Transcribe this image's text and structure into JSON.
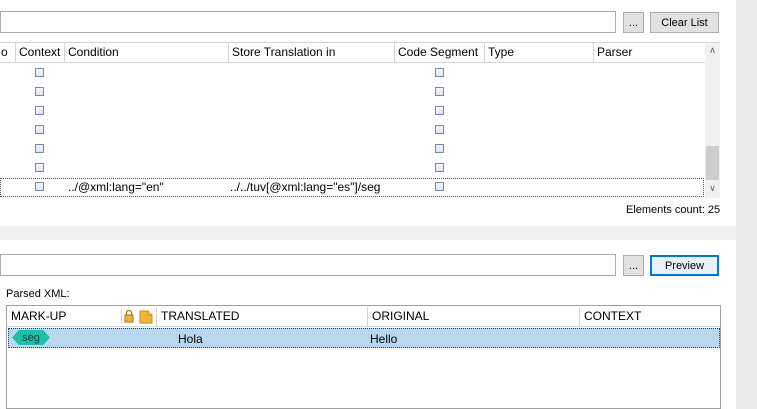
{
  "toolbar_top": {
    "browse_label": "...",
    "clear_list_label": "Clear List"
  },
  "elements_grid": {
    "columns": [
      "o",
      "Context",
      "Condition",
      "Store Translation in",
      "Code Segment",
      "Type",
      "Parser"
    ],
    "last_row": {
      "condition": "../@xml:lang=\"en\"",
      "store_translation_in": "../../tuv[@xml:lang=\"es\"]/seg"
    },
    "elements_count": "Elements count: 25"
  },
  "preview_bar": {
    "browse_label": "...",
    "preview_label": "Preview"
  },
  "parsed_xml": {
    "label": "Parsed XML:",
    "columns": [
      "MARK-UP",
      "TRANSLATED",
      "ORIGINAL",
      "CONTEXT"
    ],
    "rows": [
      {
        "markup": "seg",
        "translated": "Hola",
        "original": "Hello",
        "context": ""
      }
    ]
  },
  "colors": {
    "accent": "#0078d7",
    "selection": "#b9d7f0",
    "tag": "#1cc0a8"
  }
}
